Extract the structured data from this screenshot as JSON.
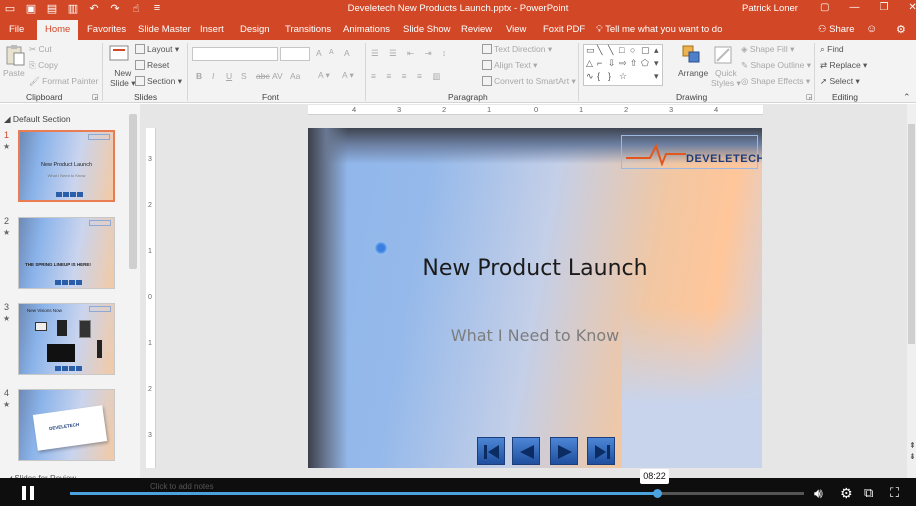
{
  "window": {
    "title": "Develetech New Products Launch.pptx - PowerPoint",
    "user": "Patrick Loner",
    "quick_access": [
      "save-icon",
      "save-as-icon",
      "new-icon",
      "open-icon",
      "undo-icon",
      "redo-icon",
      "touch-icon"
    ]
  },
  "tabs": [
    {
      "label": "File"
    },
    {
      "label": "Home"
    },
    {
      "label": "Favorites"
    },
    {
      "label": "Slide Master"
    },
    {
      "label": "Insert"
    },
    {
      "label": "Design"
    },
    {
      "label": "Transitions"
    },
    {
      "label": "Animations"
    },
    {
      "label": "Slide Show"
    },
    {
      "label": "Review"
    },
    {
      "label": "View"
    },
    {
      "label": "Foxit PDF"
    }
  ],
  "tell_me": "Tell me what you want to do",
  "share": "Share",
  "ribbon": {
    "clipboard": {
      "label": "Clipboard",
      "paste": "Paste",
      "cut": "Cut",
      "copy": "Copy",
      "format_painter": "Format Painter"
    },
    "slides": {
      "label": "Slides",
      "new_slide_1": "New",
      "new_slide_2": "Slide",
      "layout": "Layout",
      "reset": "Reset",
      "section": "Section"
    },
    "font": {
      "label": "Font",
      "bold": "B",
      "italic": "I",
      "underline": "U",
      "shadow": "S",
      "strike": "abc",
      "spacing": "AV",
      "case": "Aa",
      "grow": "A",
      "shrink": "A",
      "clear": "A"
    },
    "paragraph": {
      "label": "Paragraph",
      "text_direction": "Text Direction",
      "align_text": "Align Text",
      "smartart": "Convert to SmartArt"
    },
    "drawing": {
      "label": "Drawing",
      "arrange": "Arrange",
      "quick_styles_1": "Quick",
      "quick_styles_2": "Styles",
      "shape_fill": "Shape Fill",
      "shape_outline": "Shape Outline",
      "shape_effects": "Shape Effects"
    },
    "editing": {
      "label": "Editing",
      "find": "Find",
      "replace": "Replace",
      "select": "Select"
    }
  },
  "thumbnails": {
    "section_title": "Default Section",
    "section_review": "Slides for Review",
    "slides": [
      {
        "num": "1",
        "title": "New Product Launch",
        "subtitle": "What I Need to Know"
      },
      {
        "num": "2",
        "title": "THE SPRING LINEUP IS HERE!",
        "subtitle": ""
      },
      {
        "num": "3",
        "title": "New Visions Now",
        "subtitle": ""
      },
      {
        "num": "4",
        "title": "DEVELETECH",
        "subtitle": ""
      }
    ]
  },
  "ruler": {
    "h": [
      "4",
      "3",
      "2",
      "1",
      "0",
      "1",
      "2",
      "3",
      "4"
    ],
    "v": [
      "3",
      "2",
      "1",
      "0",
      "1",
      "2",
      "3"
    ]
  },
  "slide": {
    "title": "New Product Launch",
    "subtitle": "What I Need to Know",
    "logo": "DEVELETECH",
    "nav_buttons": [
      "first-slide",
      "previous-slide",
      "next-slide",
      "last-slide"
    ]
  },
  "video": {
    "time": "08:22",
    "progress": 0.8,
    "status_ghost": "Click to add notes"
  },
  "colors": {
    "accent": "#d24726",
    "video_progress": "#4aa3df"
  }
}
